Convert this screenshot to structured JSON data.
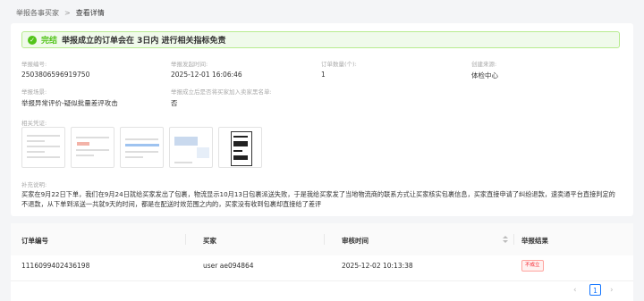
{
  "breadcrumb": {
    "parent": "举报各事买家",
    "separator": ">",
    "current": "查看详情"
  },
  "banner": {
    "status": "完结",
    "message": "举报成立的订单会在 3日内 进行相关指标免责"
  },
  "fields": {
    "report_no": {
      "label": "举报编号:",
      "value": "2503806596919750"
    },
    "report_time": {
      "label": "举报发起时间:",
      "value": "2025-12-01 16:06:46"
    },
    "order_count": {
      "label": "订单数量(个):",
      "value": "1"
    },
    "source": {
      "label": "创建来源:",
      "value": "体检中心"
    },
    "reason": {
      "label": "举报场景:",
      "value": "举报异常评价-疑似批量差评攻击"
    },
    "blacklist": {
      "label": "举报成立后是否将买家加入卖家黑名单:",
      "value": "否"
    }
  },
  "proof": {
    "label": "相关凭证:"
  },
  "note": {
    "label": "补充说明:",
    "text": "买家在9月22日下单，我们在9月24日就给买家发出了包裹，物流显示10月13日包裹派送失败，于是我给买家发了当地物流商的联系方式让买家核实包裹信息，买家直接申请了纠纷退款，速卖通平台直接判定的不退款，从下单到派送一共就9天的时间，都是在配送时效范围之内的，买家没有收到包裹却直接给了差评"
  },
  "table": {
    "headers": [
      "订单编号",
      "买家",
      "审核时间",
      "举报结果"
    ],
    "rows": [
      {
        "order_no": "1116099402436198",
        "buyer": "user ae094864",
        "review_time": "2025-12-02 10:13:38",
        "result": "不成立"
      }
    ]
  },
  "pagination": {
    "prev": "‹",
    "current_page": "1",
    "next": "›"
  },
  "colors": {
    "success": "#52c41a",
    "primary": "#1677ff",
    "danger": "#f5222d"
  }
}
